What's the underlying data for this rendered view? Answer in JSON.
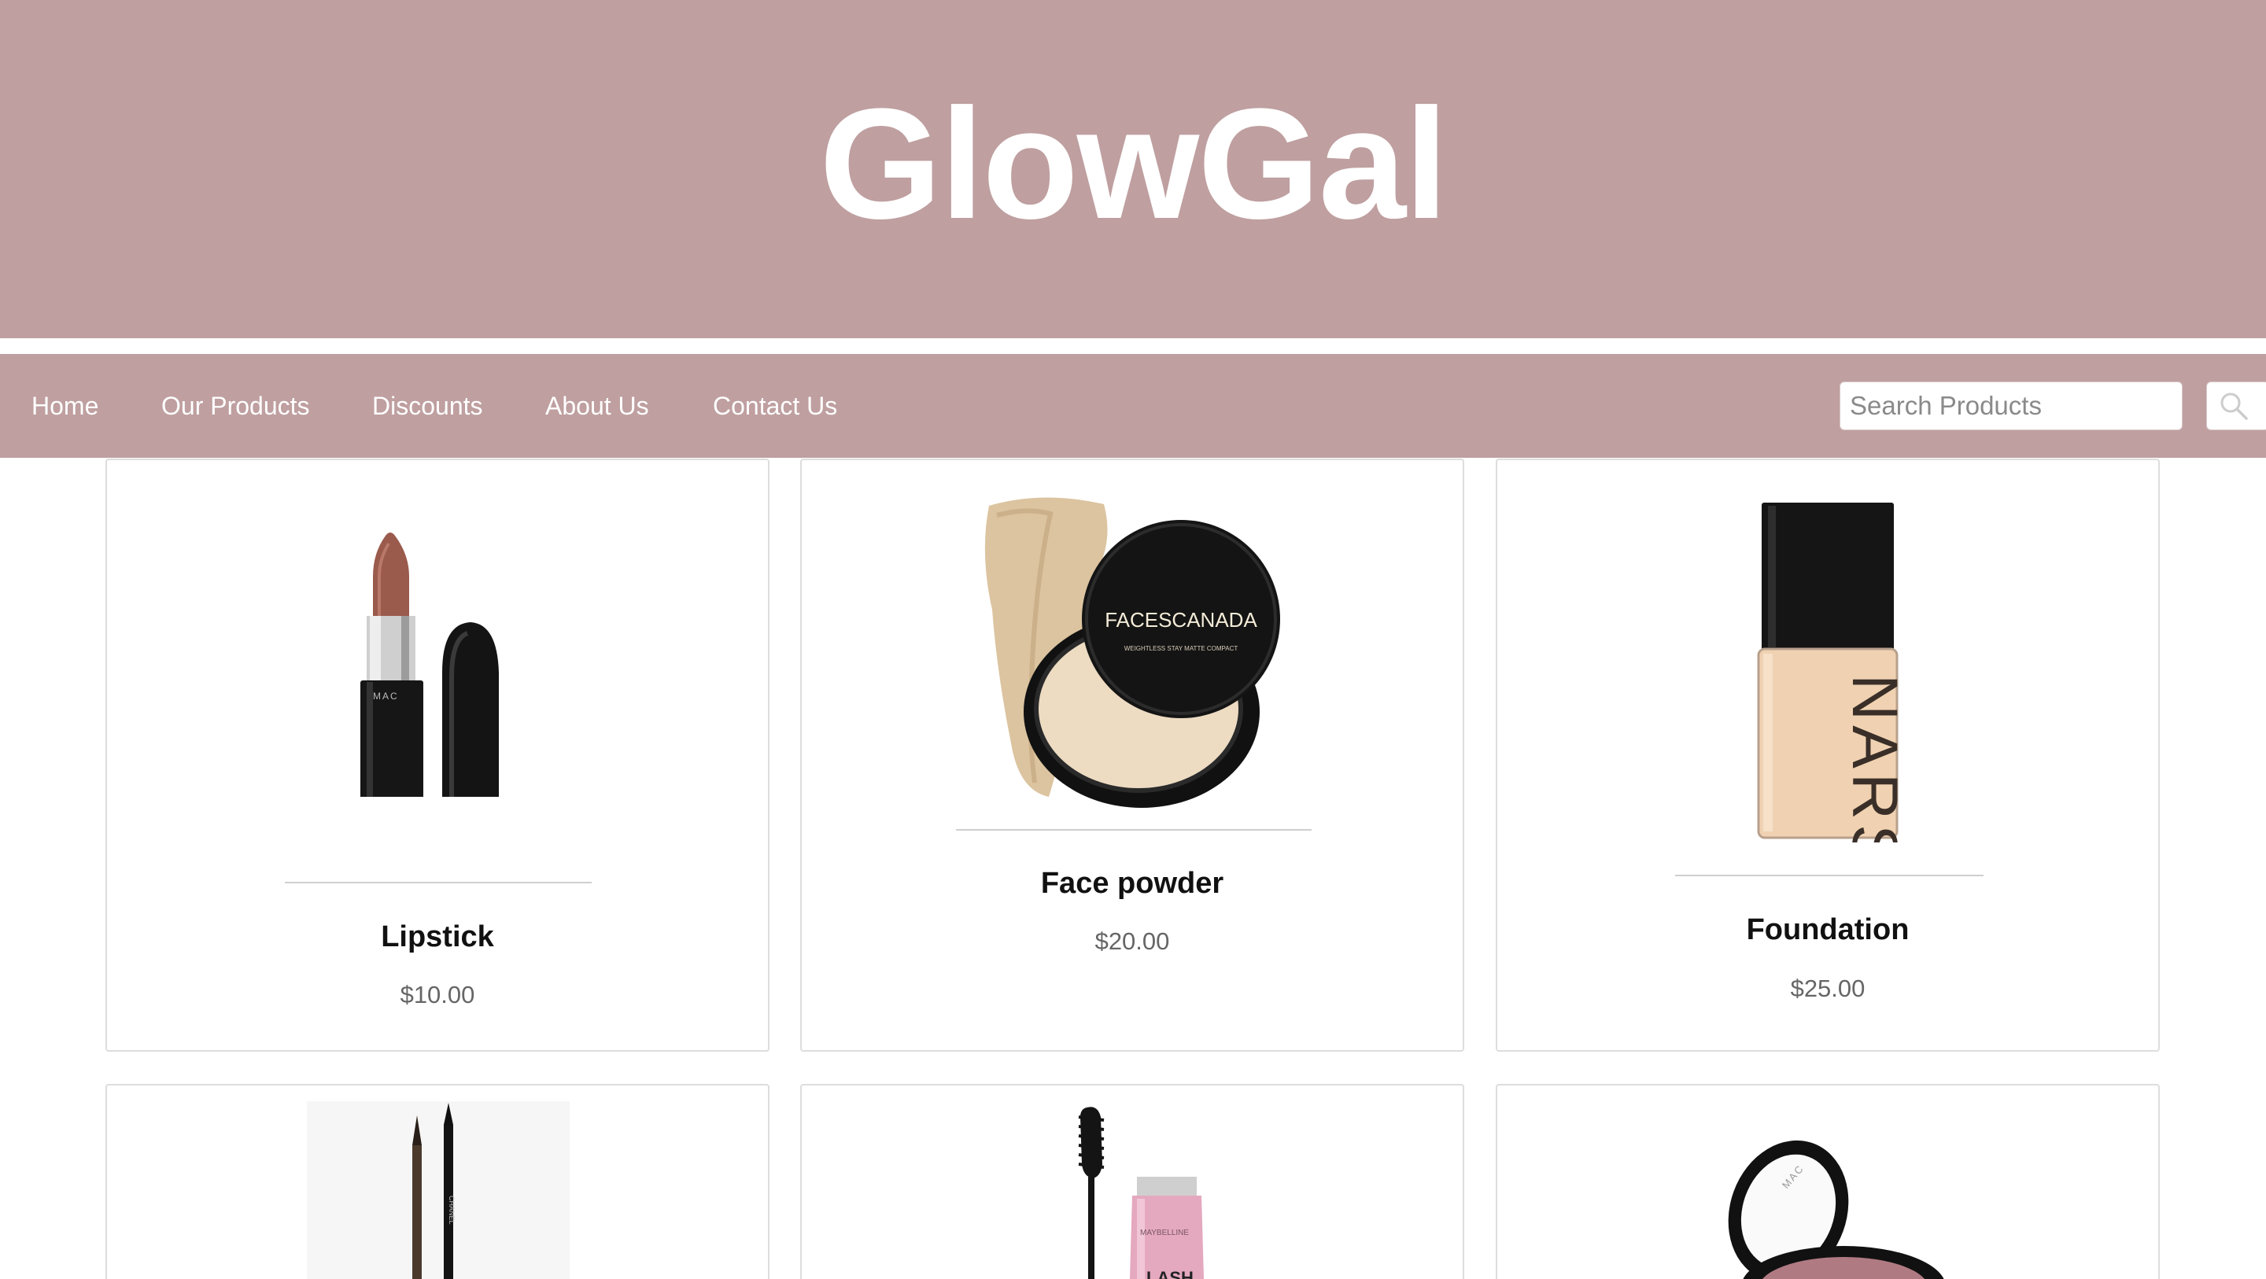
{
  "brand": {
    "title": "GlowGal"
  },
  "nav": {
    "items": [
      {
        "label": "Home"
      },
      {
        "label": "Our Products"
      },
      {
        "label": "Discounts"
      },
      {
        "label": "About Us"
      },
      {
        "label": "Contact Us"
      }
    ],
    "search": {
      "placeholder": "Search Products",
      "value": "",
      "button_icon": "search-icon"
    }
  },
  "colors": {
    "header_bg": "#bf9fa0",
    "nav_text": "#ffffff",
    "price_text": "#666666"
  },
  "products": [
    {
      "name": "Lipstick",
      "price": "$10.00",
      "image_icon": "lipstick-icon"
    },
    {
      "name": "Face powder",
      "price": "$20.00",
      "image_icon": "compact-powder-icon",
      "image_brand": "FACESCANADA",
      "image_subtitle": "WEIGHTLESS STAY MATTE COMPACT"
    },
    {
      "name": "Foundation",
      "price": "$25.00",
      "image_icon": "foundation-bottle-icon",
      "image_brand": "NARS"
    },
    {
      "name": "",
      "price": "",
      "image_icon": "eyeliner-pencil-icon",
      "image_brand": "CHANEL"
    },
    {
      "name": "",
      "price": "",
      "image_icon": "mascara-icon",
      "image_brand": "MAYBELLINE",
      "image_label": "LASH"
    },
    {
      "name": "",
      "price": "",
      "image_icon": "blush-compact-icon",
      "image_brand": "MAC"
    }
  ]
}
